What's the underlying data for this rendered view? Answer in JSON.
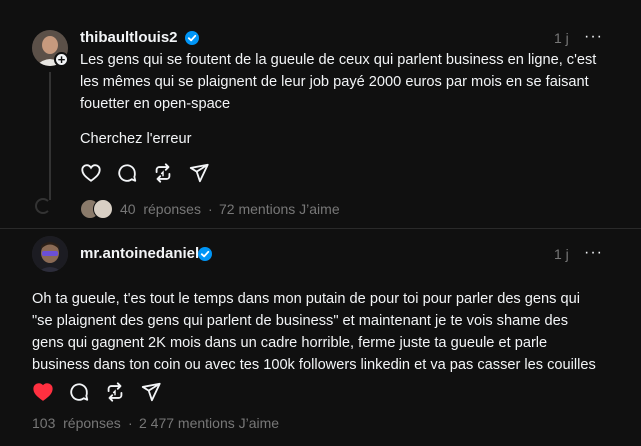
{
  "post1": {
    "username": "thibaultlouis2",
    "time": "1 j",
    "more": "···",
    "text_line1": "Les gens qui se foutent de la gueule de ceux qui parlent business en ligne, c'est",
    "text_line2": "les mêmes qui se plaignent de leur job payé 2000 euros par mois en se faisant",
    "text_line3": "fouetter en open-space",
    "text_line4": "Cherchez l'erreur",
    "replies": "40  réponses",
    "dot": "·",
    "likes": "72 mentions J’aime"
  },
  "post2": {
    "username": "mr.antoinedaniel",
    "time": "1 j",
    "more": "···",
    "text_line1": "Oh ta gueule, t'es tout le temps dans mon putain de pour toi pour parler des gens qui",
    "text_line2": "\"se plaignent des gens qui parlent de business\" et maintenant je te vois shame des",
    "text_line3": "gens qui gagnent 2K mois dans un cadre horrible, ferme juste ta gueule et parle",
    "text_line4": "business dans ton coin ou avec tes 100k followers linkedin et va pas casser les couilles",
    "replies": "103  réponses",
    "dot": "·",
    "likes": "2 477 mentions J’aime"
  },
  "colors": {
    "accent_like": "#ff3040",
    "verified": "#0095f6",
    "muted": "#777777"
  }
}
